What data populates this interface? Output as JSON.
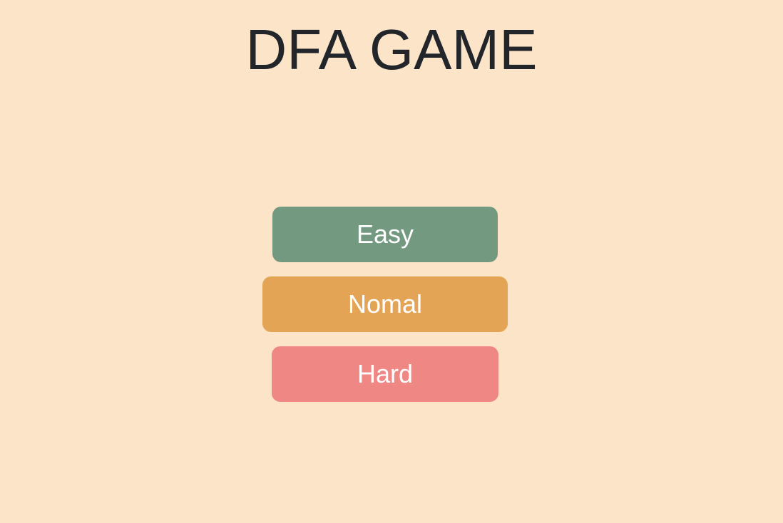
{
  "title": "DFA GAME",
  "buttons": {
    "easy": {
      "label": "Easy",
      "color": "#739A80"
    },
    "normal": {
      "label": "Nomal",
      "color": "#E3A555"
    },
    "hard": {
      "label": "Hard",
      "color": "#EF8785"
    }
  },
  "colors": {
    "background": "#FBE4C8",
    "title_text": "#22262B",
    "button_text": "#FFFFFF"
  }
}
